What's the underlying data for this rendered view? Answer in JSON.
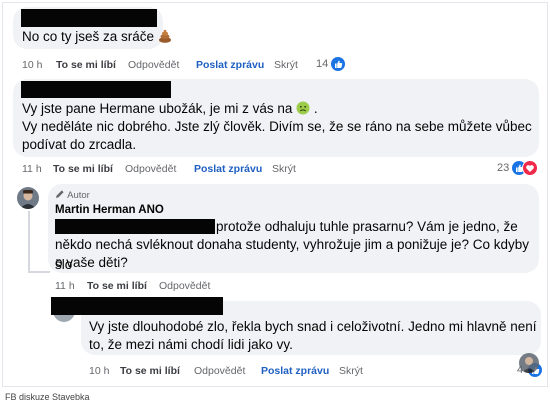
{
  "comments": [
    {
      "text": "No co ty jseš za sráče",
      "emoji": "poop-emoji",
      "time": "10 h",
      "like": "To se mi líbí",
      "reply": "Odpovědět",
      "message": "Poslat zprávu",
      "hide": "Skrýt",
      "reactions": "14"
    },
    {
      "line1": "Vy jste pane Hermane ubožák, je mi z vás na",
      "emoji": "nauseated-emoji",
      "line2": "Vy neděláte nic dobrého. Jste zlý člověk. Divím se, že se ráno na sebe můžete vůbec",
      "line3": "podívat do zrcadla.",
      "time": "11 h",
      "like": "To se mi líbí",
      "reply": "Odpovědět",
      "message": "Poslat zprávu",
      "hide": "Skrýt",
      "reactions": "23"
    },
    {
      "author_tag": "Autor",
      "author": "Martin Herman ANO",
      "line1": "protože odhaluju tuhle prasarnu? Vám je jedno, že",
      "line2": "někdo nechá svléknout donaha studenty, vyhrožuje jim a ponižuje je? Co kdyby šlo",
      "line3": "o vaše děti?",
      "time": "11 h",
      "like": "To se mi líbí",
      "reply": "Odpovědět"
    },
    {
      "line1": "Vy jste dlouhodobé zlo, řekla bych snad i celoživotní. Jedno mi hlavně není",
      "line2": "to, že mezi námi chodí lidi jako vy.",
      "time": "10 h",
      "like": "To se mi líbí",
      "reply": "Odpovědět",
      "message": "Poslat zprávu",
      "hide": "Skrýt",
      "reactions": "4"
    }
  ],
  "caption": "FB diskuze Stavebka",
  "colors": {
    "like": "#1b74e4",
    "love": "#f0284a",
    "link": "#1f5fc2",
    "bubble": "#f0f2f5"
  }
}
